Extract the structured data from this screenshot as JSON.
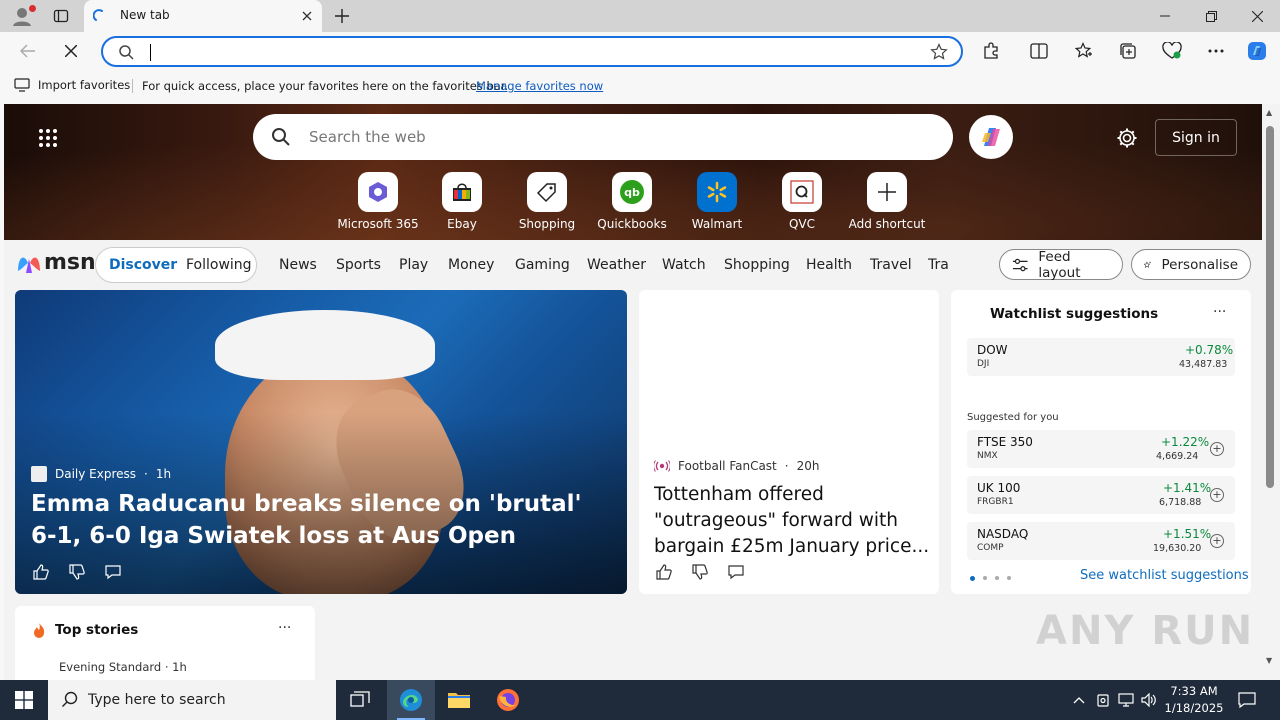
{
  "browser": {
    "tab_title": "New tab",
    "address_value": "",
    "favbar": {
      "import_label": "Import favorites",
      "message": "For quick access, place your favorites here on the favorites bar.",
      "manage_link": "Manage favorites now"
    }
  },
  "msn": {
    "search_placeholder": "Search the web",
    "sign_in": "Sign in",
    "shortcuts": [
      {
        "label": "Microsoft 365",
        "icon": "microsoft-365-icon"
      },
      {
        "label": "Ebay",
        "icon": "ebay-icon"
      },
      {
        "label": "Shopping",
        "icon": "shopping-tag-icon"
      },
      {
        "label": "Quickbooks",
        "icon": "quickbooks-icon"
      },
      {
        "label": "Walmart",
        "icon": "walmart-icon"
      },
      {
        "label": "QVC",
        "icon": "qvc-icon"
      },
      {
        "label": "Add shortcut",
        "icon": "plus-icon"
      }
    ],
    "logo_text": "msn",
    "nav": {
      "discover": "Discover",
      "following": "Following",
      "items": [
        "News",
        "Sports",
        "Play",
        "Money",
        "Gaming",
        "Weather",
        "Watch",
        "Shopping",
        "Health",
        "Travel",
        "Tra"
      ],
      "feed_layout": "Feed layout",
      "personalise": "Personalise"
    },
    "hero_story": {
      "source": "Daily Express",
      "age": "1h",
      "headline": "Emma Raducanu breaks silence on 'brutal' 6-1, 6-0 Iga Swiatek loss at Aus Open"
    },
    "story2": {
      "source": "Football FanCast",
      "age": "20h",
      "headline": "Tottenham offered \"outrageous\" forward with bargain £25m January price..."
    },
    "watchlist": {
      "title": "Watchlist suggestions",
      "main": {
        "name": "DOW",
        "ticker": "DJI",
        "change": "+0.78%",
        "value": "43,487.83"
      },
      "suggested_label": "Suggested for you",
      "suggested": [
        {
          "name": "FTSE 350",
          "ticker": "NMX",
          "change": "+1.22%",
          "value": "4,669.24"
        },
        {
          "name": "UK 100",
          "ticker": "FRGBR1",
          "change": "+1.41%",
          "value": "6,718.88"
        },
        {
          "name": "NASDAQ",
          "ticker": "COMP",
          "change": "+1.51%",
          "value": "19,630.20"
        }
      ],
      "see_more": "See watchlist suggestions",
      "more_label": "···"
    },
    "top_stories": {
      "title": "Top stories",
      "first_source": "Evening Standard",
      "first_age": "1h",
      "more_label": "···"
    }
  },
  "watermark": "ANY RUN",
  "taskbar": {
    "search_placeholder": "Type here to search",
    "time": "7:33 AM",
    "date": "1/18/2025"
  },
  "colors": {
    "accent": "#0f6cbd",
    "stock_positive": "#0b8a3e",
    "address_border": "#1a6fe0"
  }
}
